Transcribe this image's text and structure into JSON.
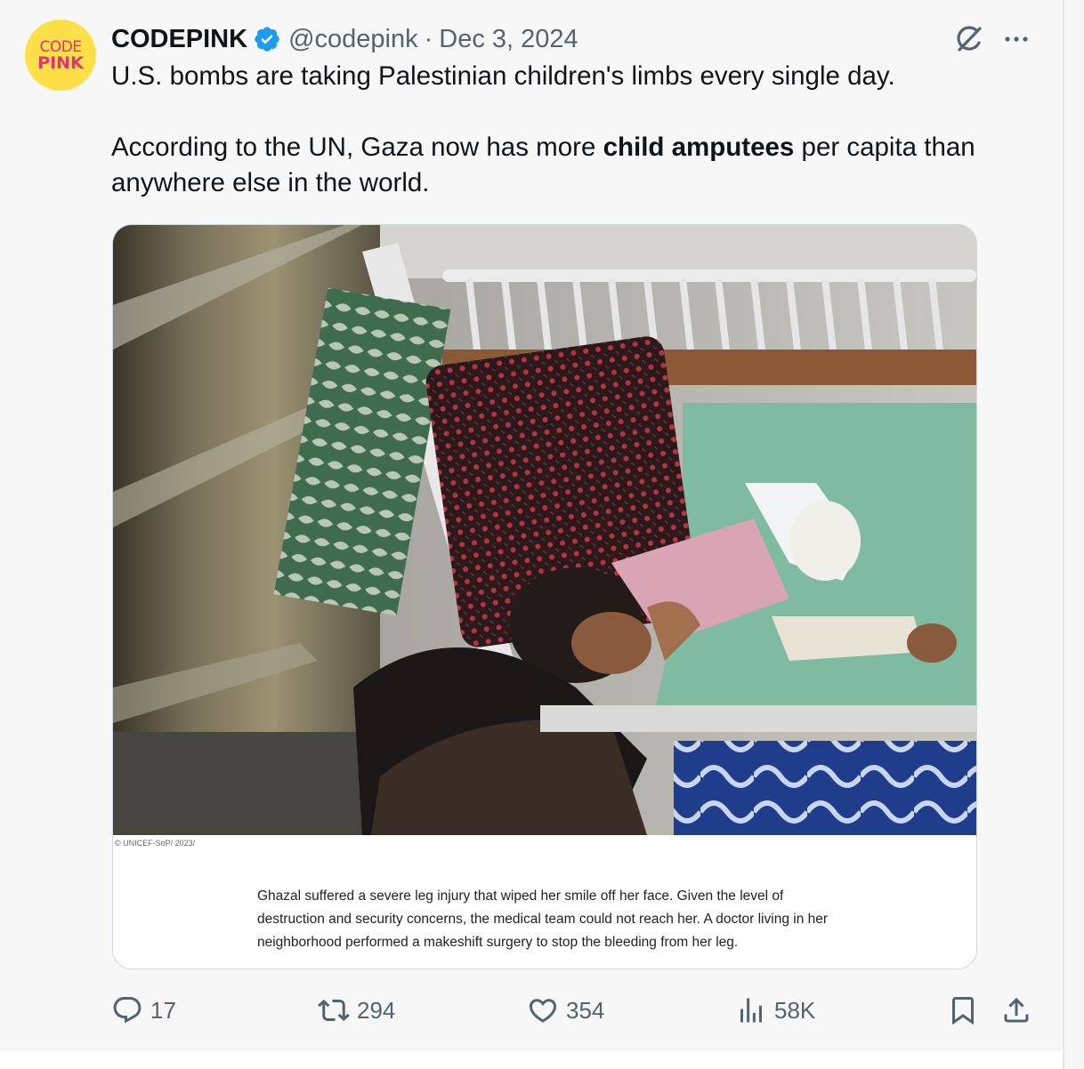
{
  "tweet": {
    "avatar_line1": "CODE",
    "avatar_line2": "PINK",
    "display_name": "CODEPINK",
    "handle": "@codepink",
    "separator": "·",
    "date": "Dec 3, 2024",
    "text_line1": "U.S. bombs are taking Palestinian children's limbs every single day.",
    "text_p2_before": "According to the UN, Gaza now has more ",
    "text_p2_bold": "child amputees",
    "text_p2_after": " per capita than anywhere else in the world."
  },
  "card": {
    "credit": "© UNICEF-SoP/ 2023/",
    "caption": "Ghazal suffered a severe leg injury that wiped her smile off her face. Given the level of destruction and security concerns, the medical team could not reach her. A doctor living in her neighborhood performed a makeshift surgery to stop the bleeding from her leg."
  },
  "actions": {
    "replies": "17",
    "reposts": "294",
    "likes": "354",
    "views": "58K"
  },
  "icons": {
    "verified": "verified-badge-icon",
    "grok": "grok-icon",
    "more": "more-icon",
    "reply": "reply-icon",
    "repost": "repost-icon",
    "like": "heart-icon",
    "views": "views-icon",
    "bookmark": "bookmark-icon",
    "share": "share-icon"
  },
  "colors": {
    "verified": "#1d9bf0",
    "text": "#0f1419",
    "muted": "#536471",
    "avatar_bg": "#fde047",
    "avatar_text": "#e0337a"
  }
}
